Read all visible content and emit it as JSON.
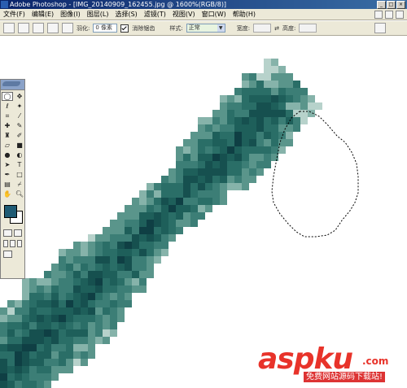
{
  "window": {
    "title": "Adobe Photoshop - [IMG_20140909_162455.jpg @ 1600%(RGB/8)]",
    "buttons": [
      "_",
      "□",
      "×"
    ]
  },
  "menubar": {
    "items": [
      "文件(F)",
      "编辑(E)",
      "图像(I)",
      "图层(L)",
      "选择(S)",
      "滤镜(T)",
      "视图(V)",
      "窗口(W)",
      "帮助(H)"
    ]
  },
  "options": {
    "feather_label": "羽化:",
    "feather_value": "0 像素",
    "antialias_label": "消除锯齿",
    "antialias_checked": true,
    "style_label": "样式:",
    "style_value": "正常",
    "width_label": "宽度:",
    "height_label": "高度:"
  },
  "tools": [
    "marquee-tool",
    "move-tool",
    "lasso-tool",
    "magic-wand-tool",
    "crop-tool",
    "slice-tool",
    "healing-brush-tool",
    "brush-tool",
    "clone-stamp-tool",
    "history-brush-tool",
    "eraser-tool",
    "gradient-tool",
    "blur-tool",
    "dodge-tool",
    "path-selection-tool",
    "type-tool",
    "pen-tool",
    "shape-tool",
    "notes-tool",
    "eyedropper-tool",
    "hand-tool",
    "zoom-tool"
  ],
  "colors": {
    "foreground": "#1f5b74",
    "background": "#ffffff",
    "accent": "#0a246a",
    "watermark": "#e8332a"
  },
  "watermark": {
    "logo": "aspku",
    "sub": ".com",
    "tagline": "免费网站源码下载站!"
  }
}
